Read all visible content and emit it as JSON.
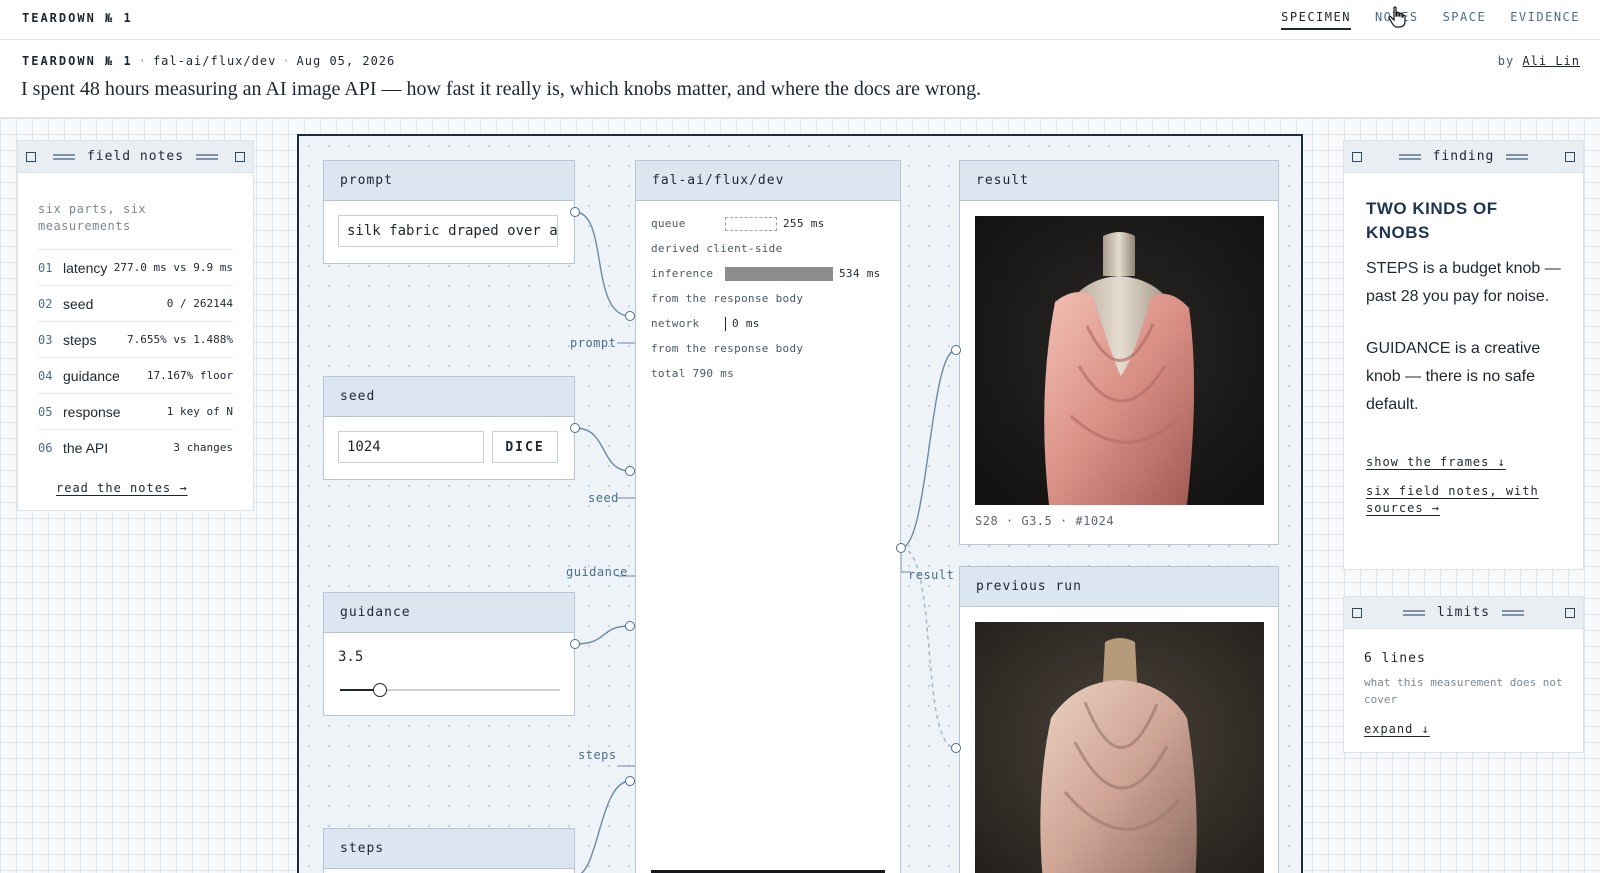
{
  "nav": {
    "brand": "TEARDOWN № 1",
    "items": [
      {
        "label": "SPECIMEN",
        "active": true
      },
      {
        "label": "NOTES",
        "active": false
      },
      {
        "label": "SPACE",
        "active": false
      },
      {
        "label": "EVIDENCE",
        "active": false
      }
    ]
  },
  "header": {
    "issue": "TEARDOWN № 1",
    "model": "fal-ai/flux/dev",
    "date": "Aug 05, 2026",
    "by_prefix": "by",
    "author": "Ali Lin",
    "headline": "I spent 48 hours measuring an AI image API — how fast it really is, which knobs matter, and where the docs are wrong."
  },
  "field_notes": {
    "title": "field notes",
    "subtitle": "six parts, six measurements",
    "rows": [
      {
        "num": "01",
        "label": "latency",
        "value": "277.0 ms vs 9.9 ms"
      },
      {
        "num": "02",
        "label": "seed",
        "value": "0 / 262144"
      },
      {
        "num": "03",
        "label": "steps",
        "value": "7.655% vs 1.488%"
      },
      {
        "num": "04",
        "label": "guidance",
        "value": "17.167% floor"
      },
      {
        "num": "05",
        "label": "response",
        "value": "1 key of N"
      },
      {
        "num": "06",
        "label": "the API",
        "value": "3 changes"
      }
    ],
    "link": "read the notes →"
  },
  "specimen": {
    "prompt": {
      "title": "prompt",
      "value": "silk fabric draped over a dress form",
      "wire": "prompt"
    },
    "seed": {
      "title": "seed",
      "value": "1024",
      "button": "DICE",
      "wire": "seed"
    },
    "guidance": {
      "title": "guidance",
      "value": "3.5",
      "level_fraction": 0.15,
      "wire": "guidance"
    },
    "steps": {
      "title": "steps",
      "wire": "steps"
    },
    "model": {
      "title": "fal-ai/flux/dev",
      "queue_label": "queue",
      "queue_ms": "255 ms",
      "queue_note": "derived client-side",
      "inference_label": "inference",
      "inference_ms": "534 ms",
      "inference_note": "from the response body",
      "network_label": "network",
      "network_ms": "0 ms",
      "network_note": "from the response body",
      "total": "total 790 ms"
    },
    "result": {
      "title": "result",
      "caption": "S28 · G3.5 · #1024",
      "wire": "result"
    },
    "previous": {
      "title": "previous run"
    }
  },
  "finding": {
    "title": "finding",
    "headline": "TWO KINDS OF KNOBS",
    "p1": "STEPS is a budget knob — past 28 you pay for noise.",
    "p2": "GUIDANCE is a creative knob — there is no safe default.",
    "link1": "show the frames ↓",
    "link2": "six field notes, with sources →"
  },
  "limits": {
    "title": "limits",
    "count": "6 lines",
    "desc": "what this measurement does not cover",
    "link": "expand ↓"
  }
}
